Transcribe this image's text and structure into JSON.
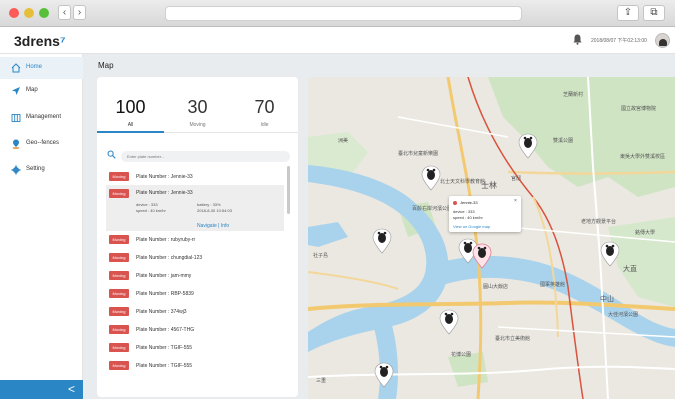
{
  "window": {
    "back": "‹",
    "forward": "›",
    "share_icon": "⇪",
    "tabs_icon": "⧉"
  },
  "app": {
    "logo": "3drens",
    "logo_mark": "⁷",
    "datetime": "2018/08/07 下午02:13:00"
  },
  "sidebar": {
    "items": [
      {
        "label": "Home",
        "icon": "home-icon",
        "active": true
      },
      {
        "label": "Map",
        "icon": "navigation-icon",
        "active": false
      },
      {
        "label": "Management",
        "icon": "columns-icon",
        "active": false
      },
      {
        "label": "Geo--fences",
        "icon": "location-icon",
        "active": false
      },
      {
        "label": "Setting",
        "icon": "gear-icon",
        "active": false
      }
    ],
    "collapse_label": "<"
  },
  "page": {
    "title": "Map"
  },
  "stats": [
    {
      "value": "100",
      "label": "All"
    },
    {
      "value": "30",
      "label": "Moving"
    },
    {
      "value": "70",
      "label": "Idle"
    }
  ],
  "search": {
    "placeholder": "Enter plate number..."
  },
  "vehicles": [
    {
      "status": "Moving",
      "plate": "Plate Number : Jennie-33"
    },
    {
      "status": "Moving",
      "plate": "Plate Number : Jennie-33"
    },
    {
      "status": "Moving",
      "plate": "Plate Number : rubyruby-rr"
    },
    {
      "status": "Moving",
      "plate": "Plate Number : chungdial-123"
    },
    {
      "status": "Moving",
      "plate": "Plate Number : jam-mmy"
    },
    {
      "status": "Moving",
      "plate": "Plate Number : RBP-5839"
    },
    {
      "status": "Moving",
      "plate": "Plate Number : 374wj3"
    },
    {
      "status": "Moving",
      "plate": "Plate Number : 4567-THG"
    },
    {
      "status": "Moving",
      "plate": "Plate Number : TGIF-555"
    },
    {
      "status": "Moving",
      "plate": "Plate Number : TGIF-555"
    }
  ],
  "selected_detail": {
    "device": "device : 333",
    "battery": "battery : 33%",
    "speed": "speed : 40 km/hr",
    "time": "2018-8-30 10:54:03",
    "navigate": "Navigate | Info"
  },
  "map": {
    "labels": [
      "臺北市兒童新樂園",
      "士林",
      "北士天文科學教育館",
      "芝蘭新村",
      "國立故宮博物院",
      "雙溪公園",
      "東吳大學外雙溪校區",
      "官邸",
      "百齡右岸河濱公園",
      "老地方觀景平台",
      "銘傳大學",
      "中山",
      "大佳河濱公園",
      "臺北市立美術館",
      "花博公園",
      "大直",
      "圓山大飯店",
      "國軍英雄館",
      "社子島",
      "洲美",
      "三重"
    ],
    "popup": {
      "title": "Jennie-33",
      "close": "×",
      "device": "device : 333",
      "speed": "speed : 40 km/hr",
      "link": "View on Google map"
    }
  }
}
